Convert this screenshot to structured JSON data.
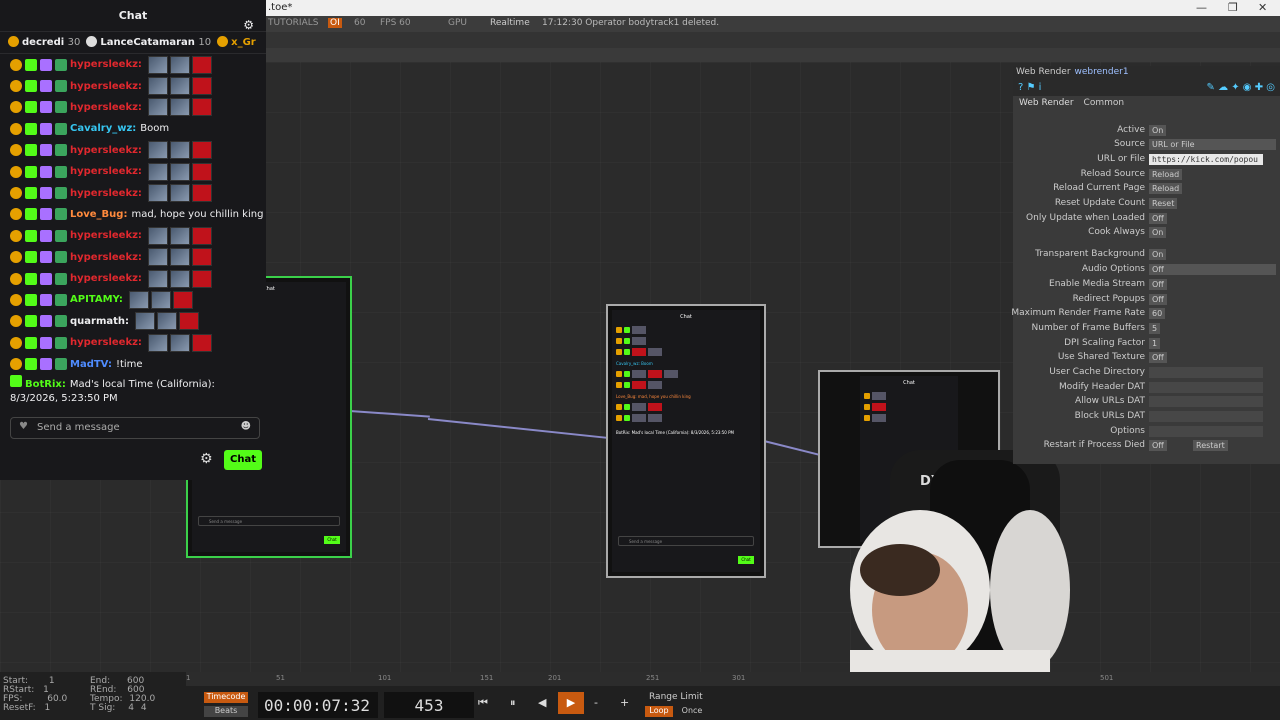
{
  "window": {
    "title": ".toe*",
    "minimize": "—",
    "maximize": "❐",
    "close": "✕"
  },
  "toolbar": {
    "tutorials": "TUTORIALS",
    "oi": "OI",
    "fps_label": "60",
    "fps": "FPS  60",
    "gpu": "GPU",
    "realtime": "Realtime",
    "status": "17:12:30 Operator bodytrack1 deleted."
  },
  "chat": {
    "title": "Chat",
    "gifters": [
      {
        "name": "decredi",
        "count": "30"
      },
      {
        "name": "LanceCatamaran",
        "count": "10"
      },
      {
        "name": "x_Gr",
        "count": ""
      }
    ],
    "messages": [
      {
        "user": "hypersleekz:",
        "color": "#e0282e",
        "text": ""
      },
      {
        "user": "hypersleekz:",
        "color": "#e0282e",
        "text": ""
      },
      {
        "user": "hypersleekz:",
        "color": "#e0282e",
        "text": ""
      },
      {
        "user": "Cavalry_wz:",
        "color": "#36c5f0",
        "text": "Boom"
      },
      {
        "user": "hypersleekz:",
        "color": "#e0282e",
        "text": ""
      },
      {
        "user": "hypersleekz:",
        "color": "#e0282e",
        "text": ""
      },
      {
        "user": "hypersleekz:",
        "color": "#e0282e",
        "text": ""
      },
      {
        "user": "Love_Bug:",
        "color": "#ff8a3d",
        "text": "mad, hope you chillin king"
      },
      {
        "user": "hypersleekz:",
        "color": "#e0282e",
        "text": ""
      },
      {
        "user": "hypersleekz:",
        "color": "#e0282e",
        "text": ""
      },
      {
        "user": "hypersleekz:",
        "color": "#e0282e",
        "text": ""
      },
      {
        "user": "APITAMY:",
        "color": "#53fc18",
        "text": ""
      },
      {
        "user": "quarmath:",
        "color": "#efeff1",
        "text": ""
      },
      {
        "user": "hypersleekz:",
        "color": "#e0282e",
        "text": ""
      },
      {
        "user": "MadTV:",
        "color": "#4f8cff",
        "text": "!time"
      }
    ],
    "bot_user": "BotRix:",
    "bot_text": "Mad's local Time (California): 8/3/2026, 5:23:50 PM",
    "input_placeholder": "Send a message",
    "chat_button": "Chat"
  },
  "mini_chat": {
    "title": "Chat",
    "send": "Send a message",
    "button": "Chat",
    "line1": "Cavalry_wz: Boom",
    "line2": "Love_Bug: mad, hope you chillin king",
    "line3": "BotRix: Mad's local Time (California): 8/3/2026, 5:23:50 PM"
  },
  "params": {
    "op_type": "Web Render",
    "op_name": "webrender1",
    "tabs": [
      "Web Render",
      "Common"
    ],
    "rows": [
      {
        "label": "Active",
        "value": "On"
      },
      {
        "label": "Source",
        "value": "URL or File"
      },
      {
        "label": "URL or File",
        "value": "https://kick.com/popou"
      },
      {
        "label": "Reload Source",
        "value": "Reload"
      },
      {
        "label": "Reload Current Page",
        "value": "Reload"
      },
      {
        "label": "Reset Update Count",
        "value": "Reset"
      },
      {
        "label": "Only Update when Loaded",
        "value": "Off"
      },
      {
        "label": "Cook Always",
        "value": "On"
      },
      {
        "label": "Transparent Background",
        "value": "On"
      },
      {
        "label": "Audio Options",
        "value": "Off"
      },
      {
        "label": "Enable Media Stream",
        "value": "Off"
      },
      {
        "label": "Redirect Popups",
        "value": "Off"
      },
      {
        "label": "Maximum Render Frame Rate",
        "value": "60"
      },
      {
        "label": "Number of Frame Buffers",
        "value": "5"
      },
      {
        "label": "DPI Scaling Factor",
        "value": "1"
      },
      {
        "label": "Use Shared Texture",
        "value": "Off"
      },
      {
        "label": "User Cache Directory",
        "value": ""
      },
      {
        "label": "Modify Header DAT",
        "value": ""
      },
      {
        "label": "Allow URLs DAT",
        "value": ""
      },
      {
        "label": "Block URLs DAT",
        "value": ""
      },
      {
        "label": "Options",
        "value": ""
      },
      {
        "label": "Restart if Process Died",
        "value": "Off"
      }
    ],
    "restart": "Restart"
  },
  "timeline": {
    "start": "Start:",
    "start_v": "1",
    "end": "End:",
    "end_v": "600",
    "rstart": "RStart:",
    "rstart_v": "1",
    "rend": "REnd:",
    "rend_v": "600",
    "fps": "FPS:",
    "fps_v": "60.0",
    "tempo": "Tempo:",
    "tempo_v": "120.0",
    "resetf": "ResetF:",
    "resetf_v": "1",
    "tsig": "T Sig:",
    "tsig_v1": "4",
    "tsig_v2": "4",
    "timecode": "Timecode",
    "beats": "Beats",
    "time": "00:00:07:32",
    "frame": "453",
    "range_limit": "Range Limit",
    "loop": "Loop",
    "once": "Once",
    "ticks": [
      "1",
      "51",
      "101",
      "151",
      "201",
      "251",
      "301",
      "501"
    ]
  }
}
